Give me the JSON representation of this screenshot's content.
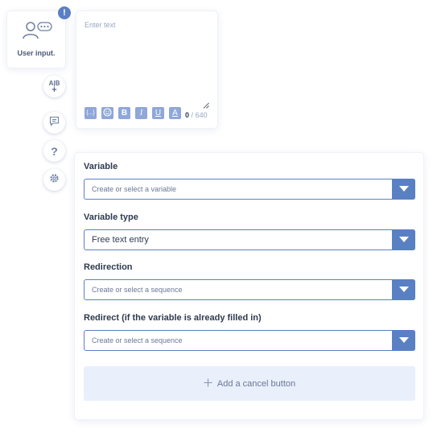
{
  "block": {
    "title": "User input.",
    "alert_symbol": "!",
    "icon": "user-input-icon"
  },
  "side_actions": {
    "ab_test": {
      "icon": "ab-test-icon",
      "top": "A|B",
      "bottom": "+"
    },
    "comment": {
      "icon": "comment-icon"
    },
    "help": {
      "icon": "help-icon",
      "label": "?"
    },
    "settings": {
      "icon": "settings-icon"
    }
  },
  "editor": {
    "placeholder": "Enter text",
    "char_count": "0",
    "char_separator": "/",
    "char_max": "640",
    "toolbar": {
      "variable_label": "{...}",
      "bold_label": "B",
      "italic_label": "I",
      "underline_label": "U",
      "color_label": "A"
    }
  },
  "form": {
    "variable": {
      "label": "Variable",
      "placeholder": "Create or select a variable"
    },
    "variable_type": {
      "label": "Variable type",
      "value": "Free text entry"
    },
    "redirection": {
      "label": "Redirection",
      "placeholder": "Create or select a sequence"
    },
    "redirect_filled": {
      "label": "Redirect (if the variable is already filled in)",
      "placeholder": "Create or select a sequence"
    },
    "cancel_button": {
      "label": "Add a cancel button",
      "icon": "plus-icon"
    }
  },
  "colors": {
    "accent": "#5a80c4",
    "badge": "#5b7fc4",
    "toolbar_button": "#8fa7d9",
    "cancel_bg": "#e9f0fb"
  }
}
